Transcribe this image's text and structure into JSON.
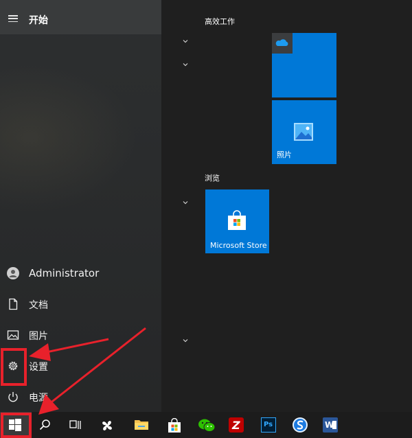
{
  "start_menu": {
    "title": "开始",
    "user": "Administrator",
    "documents": "文档",
    "pictures": "图片",
    "settings": "设置",
    "power": "电源"
  },
  "groups": {
    "productivity": {
      "title": "高效工作",
      "photos_label": "照片"
    },
    "browse": {
      "title": "浏览",
      "store_label": "Microsoft Store"
    }
  },
  "colors": {
    "tile": "#0078d7",
    "annotation": "#e8212b"
  },
  "icons": {
    "onedrive": "cloud-icon",
    "photos": "picture-icon",
    "store": "shopping-bag-icon"
  },
  "taskbar": {
    "items": [
      "windows-start-icon",
      "search-icon",
      "task-view-icon",
      "fan-app-icon",
      "file-explorer-icon",
      "store-icon",
      "wechat-icon",
      "filezilla-icon",
      "photoshop-icon",
      "sogou-browser-icon",
      "word-icon"
    ],
    "photoshop_text": "Ps",
    "filezilla_text": "Z",
    "word_text": "W"
  }
}
